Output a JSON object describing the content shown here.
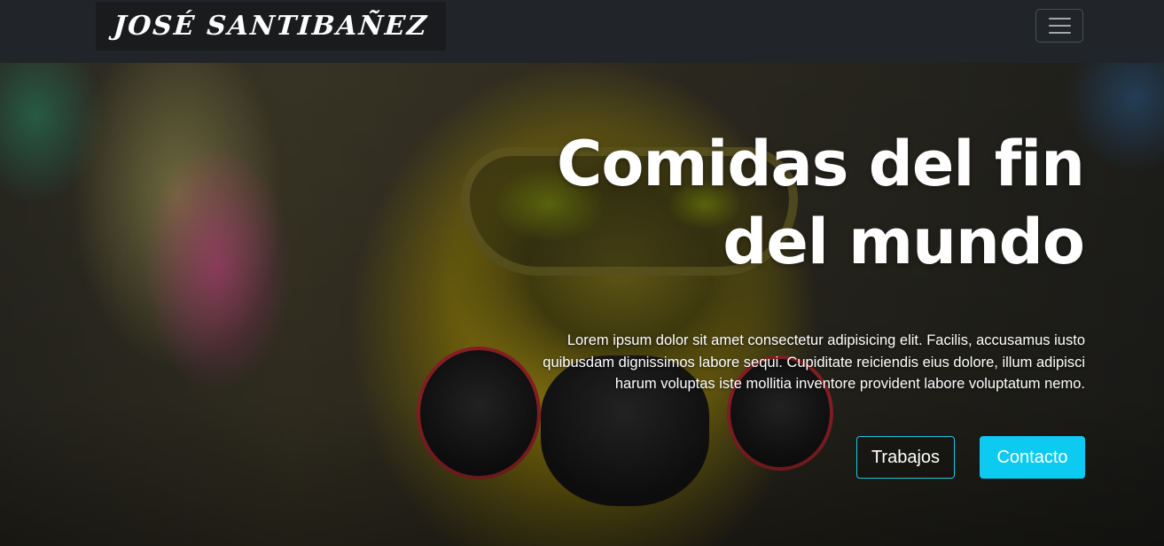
{
  "navbar": {
    "brand": "JOSÉ SANTIBAÑEZ",
    "toggler_icon": "hamburger-menu-icon",
    "background_color": "#212529"
  },
  "hero": {
    "title": "Comidas del fin del mundo",
    "description": "Lorem ipsum dolor sit amet consectetur adipisicing elit. Facilis, accusamus iusto quibusdam dignissimos labore sequi. Cupiditate reiciendis eius dolore, illum adipisci harum voluptas iste mollitia inventore provident labore voluptatum nemo.",
    "buttons": {
      "trabajos": "Trabajos",
      "contacto": "Contacto"
    },
    "accent_color": "#0dcaf0"
  }
}
